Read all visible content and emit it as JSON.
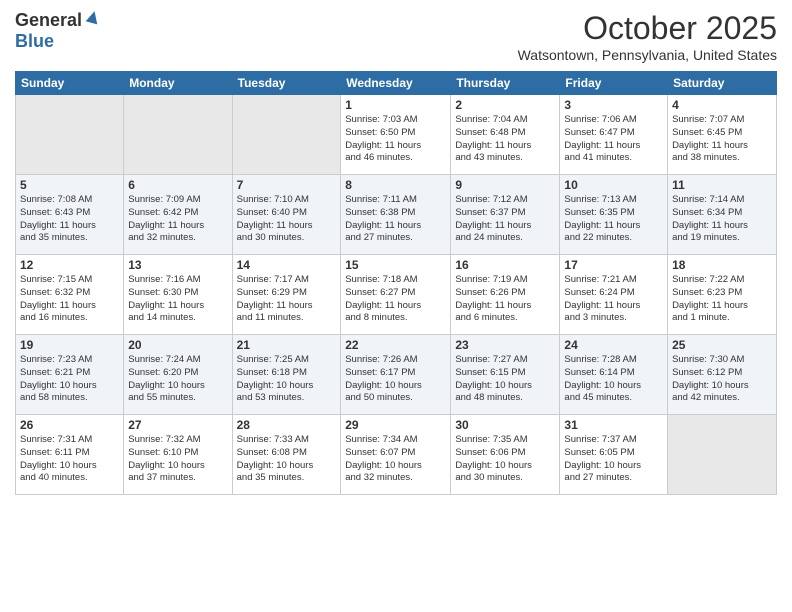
{
  "logo": {
    "general": "General",
    "blue": "Blue"
  },
  "header": {
    "month": "October 2025",
    "location": "Watsontown, Pennsylvania, United States"
  },
  "days_of_week": [
    "Sunday",
    "Monday",
    "Tuesday",
    "Wednesday",
    "Thursday",
    "Friday",
    "Saturday"
  ],
  "weeks": [
    [
      {
        "day": "",
        "info": ""
      },
      {
        "day": "",
        "info": ""
      },
      {
        "day": "",
        "info": ""
      },
      {
        "day": "1",
        "info": "Sunrise: 7:03 AM\nSunset: 6:50 PM\nDaylight: 11 hours\nand 46 minutes."
      },
      {
        "day": "2",
        "info": "Sunrise: 7:04 AM\nSunset: 6:48 PM\nDaylight: 11 hours\nand 43 minutes."
      },
      {
        "day": "3",
        "info": "Sunrise: 7:06 AM\nSunset: 6:47 PM\nDaylight: 11 hours\nand 41 minutes."
      },
      {
        "day": "4",
        "info": "Sunrise: 7:07 AM\nSunset: 6:45 PM\nDaylight: 11 hours\nand 38 minutes."
      }
    ],
    [
      {
        "day": "5",
        "info": "Sunrise: 7:08 AM\nSunset: 6:43 PM\nDaylight: 11 hours\nand 35 minutes."
      },
      {
        "day": "6",
        "info": "Sunrise: 7:09 AM\nSunset: 6:42 PM\nDaylight: 11 hours\nand 32 minutes."
      },
      {
        "day": "7",
        "info": "Sunrise: 7:10 AM\nSunset: 6:40 PM\nDaylight: 11 hours\nand 30 minutes."
      },
      {
        "day": "8",
        "info": "Sunrise: 7:11 AM\nSunset: 6:38 PM\nDaylight: 11 hours\nand 27 minutes."
      },
      {
        "day": "9",
        "info": "Sunrise: 7:12 AM\nSunset: 6:37 PM\nDaylight: 11 hours\nand 24 minutes."
      },
      {
        "day": "10",
        "info": "Sunrise: 7:13 AM\nSunset: 6:35 PM\nDaylight: 11 hours\nand 22 minutes."
      },
      {
        "day": "11",
        "info": "Sunrise: 7:14 AM\nSunset: 6:34 PM\nDaylight: 11 hours\nand 19 minutes."
      }
    ],
    [
      {
        "day": "12",
        "info": "Sunrise: 7:15 AM\nSunset: 6:32 PM\nDaylight: 11 hours\nand 16 minutes."
      },
      {
        "day": "13",
        "info": "Sunrise: 7:16 AM\nSunset: 6:30 PM\nDaylight: 11 hours\nand 14 minutes."
      },
      {
        "day": "14",
        "info": "Sunrise: 7:17 AM\nSunset: 6:29 PM\nDaylight: 11 hours\nand 11 minutes."
      },
      {
        "day": "15",
        "info": "Sunrise: 7:18 AM\nSunset: 6:27 PM\nDaylight: 11 hours\nand 8 minutes."
      },
      {
        "day": "16",
        "info": "Sunrise: 7:19 AM\nSunset: 6:26 PM\nDaylight: 11 hours\nand 6 minutes."
      },
      {
        "day": "17",
        "info": "Sunrise: 7:21 AM\nSunset: 6:24 PM\nDaylight: 11 hours\nand 3 minutes."
      },
      {
        "day": "18",
        "info": "Sunrise: 7:22 AM\nSunset: 6:23 PM\nDaylight: 11 hours\nand 1 minute."
      }
    ],
    [
      {
        "day": "19",
        "info": "Sunrise: 7:23 AM\nSunset: 6:21 PM\nDaylight: 10 hours\nand 58 minutes."
      },
      {
        "day": "20",
        "info": "Sunrise: 7:24 AM\nSunset: 6:20 PM\nDaylight: 10 hours\nand 55 minutes."
      },
      {
        "day": "21",
        "info": "Sunrise: 7:25 AM\nSunset: 6:18 PM\nDaylight: 10 hours\nand 53 minutes."
      },
      {
        "day": "22",
        "info": "Sunrise: 7:26 AM\nSunset: 6:17 PM\nDaylight: 10 hours\nand 50 minutes."
      },
      {
        "day": "23",
        "info": "Sunrise: 7:27 AM\nSunset: 6:15 PM\nDaylight: 10 hours\nand 48 minutes."
      },
      {
        "day": "24",
        "info": "Sunrise: 7:28 AM\nSunset: 6:14 PM\nDaylight: 10 hours\nand 45 minutes."
      },
      {
        "day": "25",
        "info": "Sunrise: 7:30 AM\nSunset: 6:12 PM\nDaylight: 10 hours\nand 42 minutes."
      }
    ],
    [
      {
        "day": "26",
        "info": "Sunrise: 7:31 AM\nSunset: 6:11 PM\nDaylight: 10 hours\nand 40 minutes."
      },
      {
        "day": "27",
        "info": "Sunrise: 7:32 AM\nSunset: 6:10 PM\nDaylight: 10 hours\nand 37 minutes."
      },
      {
        "day": "28",
        "info": "Sunrise: 7:33 AM\nSunset: 6:08 PM\nDaylight: 10 hours\nand 35 minutes."
      },
      {
        "day": "29",
        "info": "Sunrise: 7:34 AM\nSunset: 6:07 PM\nDaylight: 10 hours\nand 32 minutes."
      },
      {
        "day": "30",
        "info": "Sunrise: 7:35 AM\nSunset: 6:06 PM\nDaylight: 10 hours\nand 30 minutes."
      },
      {
        "day": "31",
        "info": "Sunrise: 7:37 AM\nSunset: 6:05 PM\nDaylight: 10 hours\nand 27 minutes."
      },
      {
        "day": "",
        "info": ""
      }
    ]
  ]
}
